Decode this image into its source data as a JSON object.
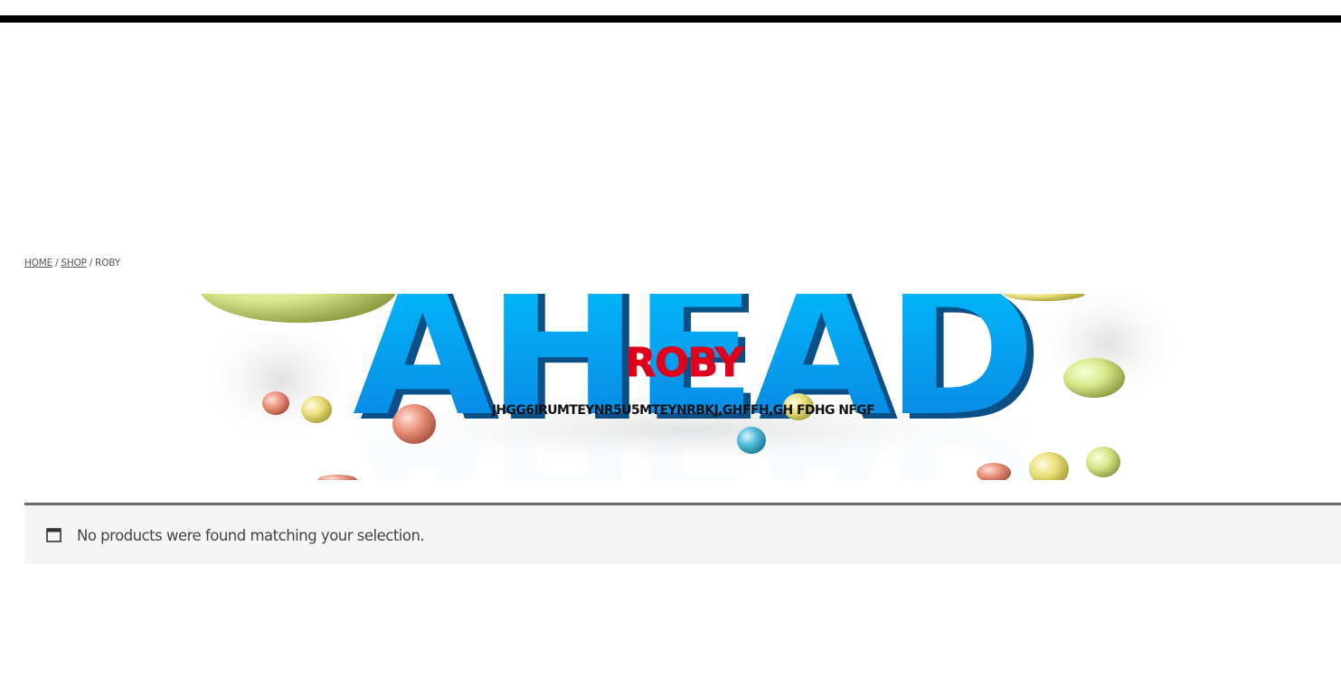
{
  "breadcrumb": {
    "home": "HOME",
    "shop": "SHOP",
    "current": "ROBY",
    "separator": "/"
  },
  "banner": {
    "image_text": "AHEAD",
    "title": "ROBY",
    "subtitle": "JHGG6IRUMTEYNR5U5MTEYNRBKJ,GHFFH,GH FDHG NFGF"
  },
  "notice": {
    "message": "No products were found matching your selection.",
    "icon": "window-icon"
  },
  "colors": {
    "title_red": "#e0001b",
    "ahead_blue": "#0aa6ee",
    "notice_border": "#6b6b6b",
    "notice_bg": "#f5f5f5"
  }
}
